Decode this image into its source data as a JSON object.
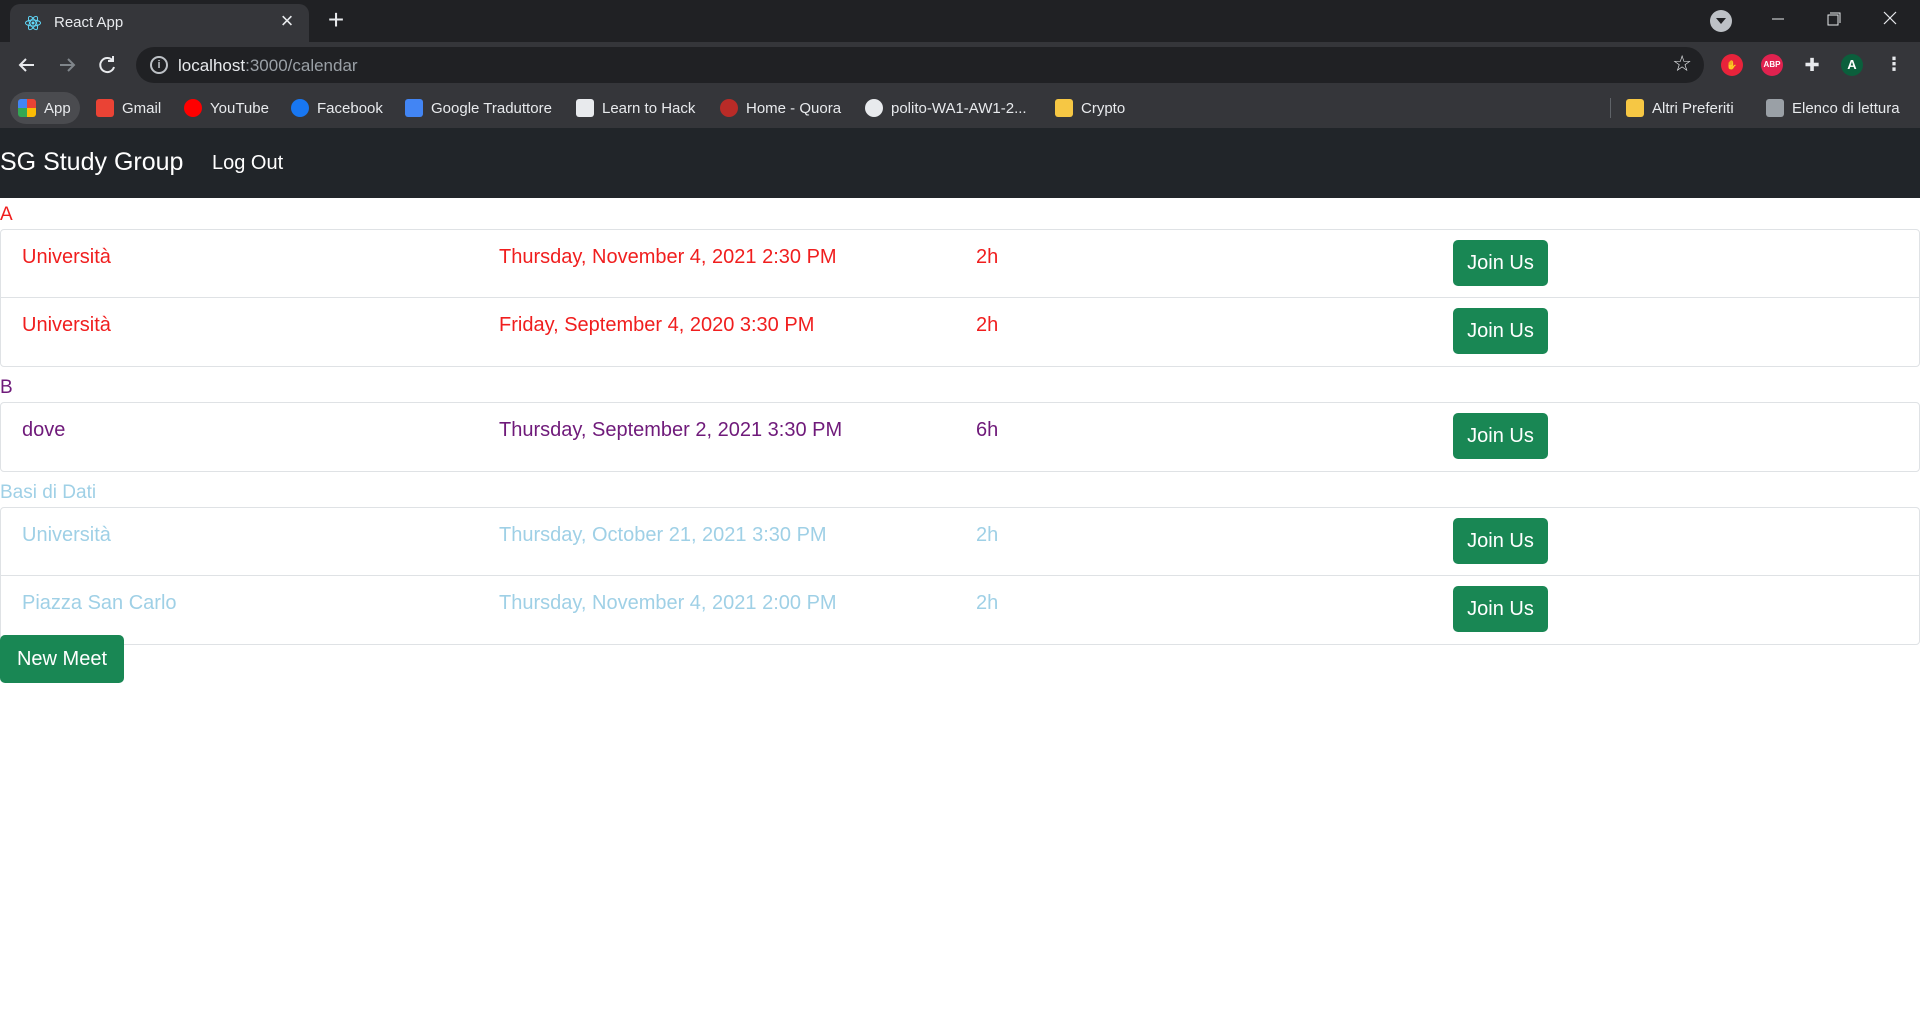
{
  "browser": {
    "tab_title": "React App",
    "url_host": "localhost",
    "url_rest": ":3000/calendar",
    "profile_initial": "A",
    "ext_abp": "ABP",
    "bookmarks": [
      {
        "label": "App",
        "icon": "apps-grid-icon"
      },
      {
        "label": "Gmail",
        "icon": "gmail-icon"
      },
      {
        "label": "YouTube",
        "icon": "youtube-icon"
      },
      {
        "label": "Facebook",
        "icon": "facebook-icon"
      },
      {
        "label": "Google Traduttore",
        "icon": "google-translate-icon"
      },
      {
        "label": "Learn to Hack",
        "icon": "hack-icon"
      },
      {
        "label": "Home - Quora",
        "icon": "quora-icon"
      },
      {
        "label": "polito-WA1-AW1-2...",
        "icon": "github-icon"
      },
      {
        "label": "Crypto",
        "icon": "folder-icon"
      }
    ],
    "bookmarks_right": [
      {
        "label": "Altri Preferiti",
        "icon": "folder-icon"
      },
      {
        "label": "Elenco di lettura",
        "icon": "reading-list-icon"
      }
    ]
  },
  "navbar": {
    "brand": "SG Study Group",
    "logout": "Log Out"
  },
  "groups": [
    {
      "name": "A",
      "color": "#f01e1e",
      "meetings": [
        {
          "place": "Università",
          "date": "Thursday, November 4, 2021 2:30 PM",
          "duration": "2h",
          "action": "Join Us"
        },
        {
          "place": "Università",
          "date": "Friday, September 4, 2020 3:30 PM",
          "duration": "2h",
          "action": "Join Us"
        }
      ]
    },
    {
      "name": "B",
      "color": "#6f1a7a",
      "meetings": [
        {
          "place": "dove",
          "date": "Thursday, September 2, 2021 3:30 PM",
          "duration": "6h",
          "action": "Join Us"
        }
      ]
    },
    {
      "name": "Basi di Dati",
      "color": "#9fd0e6",
      "meetings": [
        {
          "place": "Università",
          "date": "Thursday, October 21, 2021 3:30 PM",
          "duration": "2h",
          "action": "Join Us"
        },
        {
          "place": "Piazza San Carlo",
          "date": "Thursday, November 4, 2021 2:00 PM",
          "duration": "2h",
          "action": "Join Us"
        }
      ]
    }
  ],
  "new_meet": "New Meet",
  "colors": {
    "accent_green": "#198754",
    "navbar": "#212529",
    "chrome_dark": "#202124"
  }
}
